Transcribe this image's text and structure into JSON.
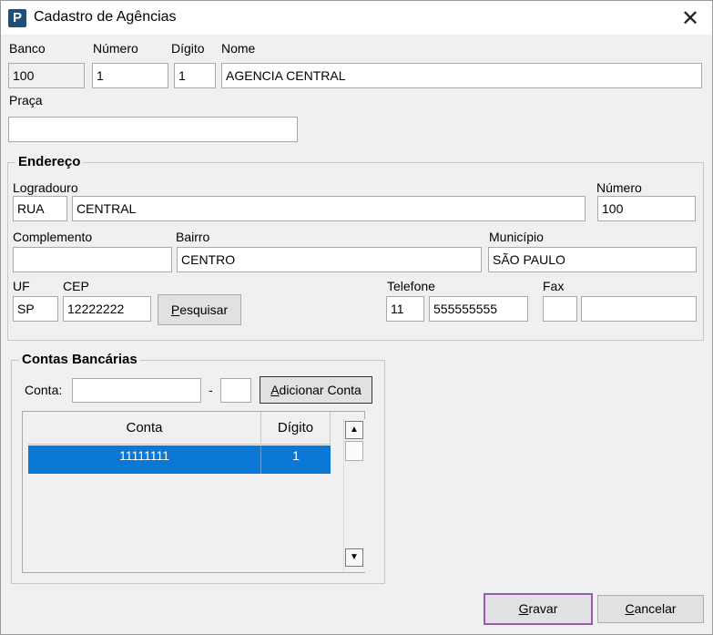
{
  "window": {
    "title": "Cadastro de Agências",
    "close_glyph": "✕",
    "icon_letter": "P"
  },
  "labels": {
    "banco": "Banco",
    "numero": "Número",
    "digito": "Dígito",
    "nome": "Nome",
    "praca": "Praça",
    "endereco": "Endereço",
    "logradouro": "Logradouro",
    "end_numero": "Número",
    "complemento": "Complemento",
    "bairro": "Bairro",
    "municipio": "Município",
    "uf": "UF",
    "cep": "CEP",
    "telefone": "Telefone",
    "fax": "Fax",
    "contas_bancarias": "Contas Bancárias",
    "conta": "Conta:",
    "dash": "-"
  },
  "values": {
    "banco": "100",
    "numero": "1",
    "digito": "1",
    "nome": "AGENCIA CENTRAL",
    "praca": "",
    "logradouro_tipo": "RUA",
    "logradouro": "CENTRAL",
    "end_numero": "100",
    "complemento": "",
    "bairro": "CENTRO",
    "municipio": "SÃO PAULO",
    "uf": "SP",
    "cep": "12222222",
    "telefone_ddd": "11",
    "telefone": "555555555",
    "fax_ddd": "",
    "fax": "",
    "conta": "",
    "conta_digito": ""
  },
  "buttons": {
    "pesquisar": {
      "accel": "P",
      "rest": "esquisar"
    },
    "adicionar_conta": {
      "accel": "A",
      "rest": "dicionar Conta"
    },
    "gravar": {
      "accel": "G",
      "rest": "ravar"
    },
    "cancelar": {
      "accel": "C",
      "rest": "ancelar"
    }
  },
  "grid": {
    "headers": [
      "Conta",
      "Dígito"
    ],
    "rows": [
      {
        "conta": "11111111",
        "digito": "1"
      }
    ]
  },
  "colors": {
    "selection": "#0b78d6",
    "focus_border": "#9b59b6",
    "icon_bg": "#1f4e79"
  }
}
